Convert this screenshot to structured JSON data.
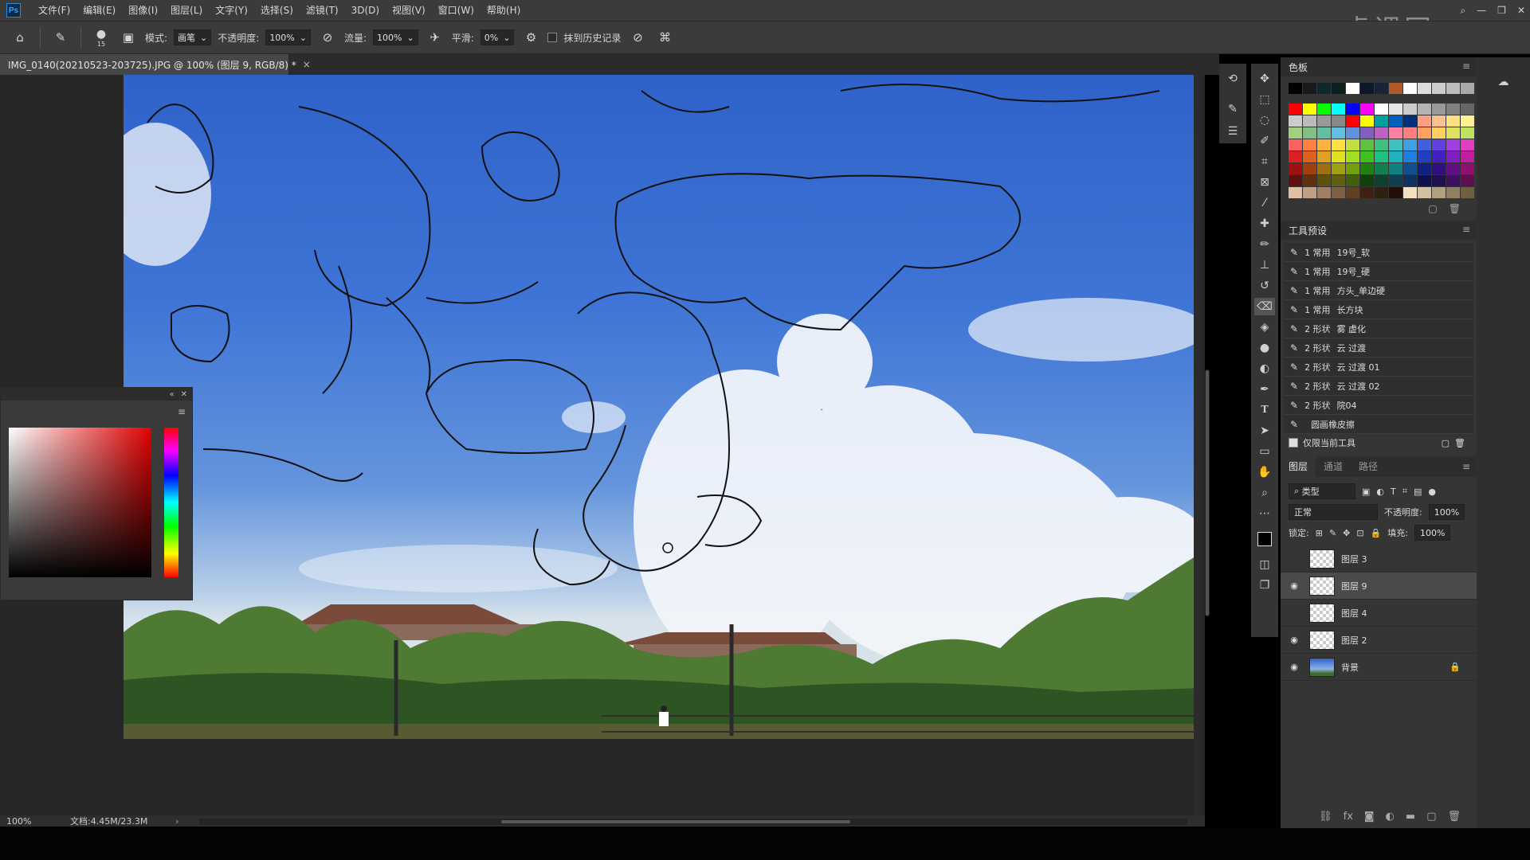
{
  "app": {
    "logo": "Ps",
    "watermark": "虎课网"
  },
  "menu": [
    "文件(F)",
    "编辑(E)",
    "图像(I)",
    "图层(L)",
    "文字(Y)",
    "选择(S)",
    "滤镜(T)",
    "3D(D)",
    "视图(V)",
    "窗口(W)",
    "帮助(H)"
  ],
  "options": {
    "brush_size": "15",
    "mode_label": "模式:",
    "mode_value": "画笔",
    "opacity_label": "不透明度:",
    "opacity_value": "100%",
    "flow_label": "流量:",
    "flow_value": "100%",
    "smooth_label": "平滑:",
    "smooth_value": "0%",
    "history_label": "抹到历史记录"
  },
  "document": {
    "tab_title": "IMG_0140(20210523-203725).JPG @ 100% (图层 9, RGB/8) *",
    "close": "×"
  },
  "status": {
    "zoom": "100%",
    "doc_size": "文档:4.45M/23.3M",
    "arrow": "›"
  },
  "swatches_panel": {
    "title": "色板"
  },
  "presets_panel": {
    "title": "工具预设",
    "items": [
      {
        "group": "1 常用",
        "name": "19号_软"
      },
      {
        "group": "1 常用",
        "name": "19号_硬"
      },
      {
        "group": "1 常用",
        "name": "方头_单边硬"
      },
      {
        "group": "1 常用",
        "name": "长方块"
      },
      {
        "group": "2 形状",
        "name": "雾 虚化"
      },
      {
        "group": "2 形状",
        "name": "云 过渡"
      },
      {
        "group": "2 形状",
        "name": "云 过渡 01"
      },
      {
        "group": "2 形状",
        "name": "云 过渡 02"
      },
      {
        "group": "2 形状",
        "name": "院04"
      },
      {
        "group": "",
        "name": "圆画橡皮擦"
      }
    ],
    "current_only_label": "仅限当前工具"
  },
  "layers_panel": {
    "tabs": [
      "图层",
      "通道",
      "路径"
    ],
    "filter_label": "类型",
    "blend_mode": "正常",
    "opacity_label": "不透明度:",
    "opacity_value": "100%",
    "lock_label": "锁定:",
    "fill_label": "填充:",
    "fill_value": "100%",
    "layers": [
      {
        "name": "图层 3",
        "visible": false,
        "active": false
      },
      {
        "name": "图层 9",
        "visible": true,
        "active": true
      },
      {
        "name": "图层 4",
        "visible": false,
        "active": false
      },
      {
        "name": "图层 2",
        "visible": true,
        "active": false
      },
      {
        "name": "背景",
        "visible": true,
        "active": false,
        "locked": true
      }
    ]
  },
  "colors": {
    "swatches_row1": [
      "#000000",
      "#1a1a1a",
      "#0d2a2a",
      "#0d1f1f",
      "#ffffff",
      "#0a1a2a",
      "#18243a",
      "#b35a2a",
      "#ffffff",
      "#dddddd",
      "#cccccc",
      "#bbbbbb",
      "#aaaaaa"
    ],
    "swatches_grid": [
      "#ff0000",
      "#ffff00",
      "#00ff00",
      "#00ffff",
      "#0000ff",
      "#ff00ff",
      "#ffffff",
      "#e6e6e6",
      "#cccccc",
      "#b3b3b3",
      "#999999",
      "#808080",
      "#666666",
      "#cccccc",
      "#bbbbbb",
      "#999999",
      "#888888",
      "#ff0000",
      "#ffff00",
      "#00a0a0",
      "#0060c0",
      "#003080",
      "#ffa080",
      "#ffc090",
      "#ffe080",
      "#fff090",
      "#a0d080",
      "#80c080",
      "#60c0a0",
      "#60c0e0",
      "#6090e0",
      "#8060c0",
      "#c060c0",
      "#ff80a0",
      "#ff8080",
      "#ffa060",
      "#ffd060",
      "#e0e060",
      "#c0e060",
      "#ff6060",
      "#ff8040",
      "#ffb040",
      "#ffe040",
      "#c0e040",
      "#60c040",
      "#40c080",
      "#40c0c0",
      "#40a0e0",
      "#4060e0",
      "#6040e0",
      "#a040e0",
      "#e040c0",
      "#e02020",
      "#e06020",
      "#e0a020",
      "#e0e020",
      "#a0e020",
      "#40c020",
      "#20c080",
      "#20b0c0",
      "#2080e0",
      "#2040c0",
      "#4020c0",
      "#8020c0",
      "#c020a0",
      "#a01010",
      "#a04010",
      "#a07010",
      "#a0a010",
      "#70a010",
      "#208010",
      "#108050",
      "#108080",
      "#105090",
      "#102080",
      "#301080",
      "#601080",
      "#901070",
      "#601010",
      "#603010",
      "#605010",
      "#606010",
      "#406010",
      "#104010",
      "#104030",
      "#104050",
      "#103060",
      "#101050",
      "#201050",
      "#401060",
      "#601050",
      "#e0c0a0",
      "#c0a080",
      "#a08060",
      "#806040",
      "#604020",
      "#402010",
      "#302010",
      "#201008",
      "#f0e0c0",
      "#d0c0a0",
      "#b0a080",
      "#908060",
      "#706040"
    ]
  }
}
